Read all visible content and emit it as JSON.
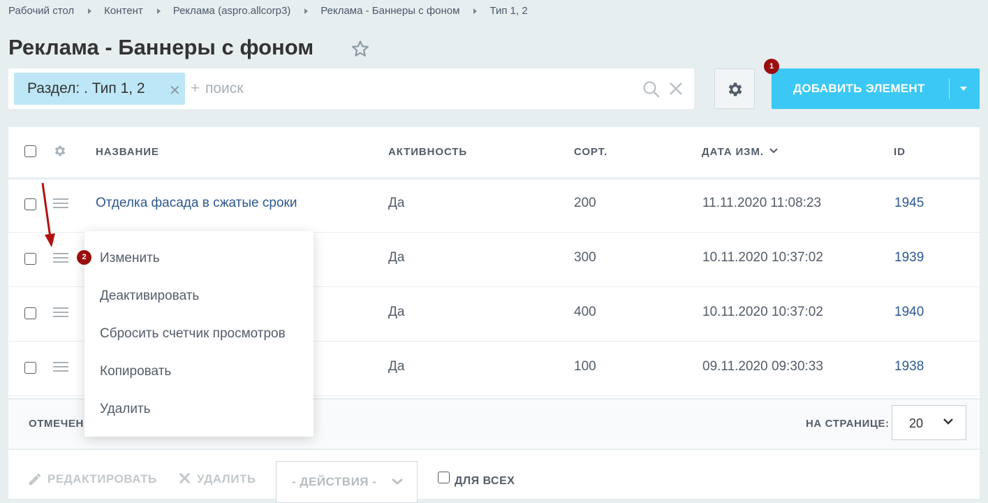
{
  "breadcrumbs": [
    "Рабочий стол",
    "Контент",
    "Реклама (aspro.allcorp3)",
    "Реклама - Баннеры с фоном",
    "Тип 1, 2"
  ],
  "page_title": "Реклама - Баннеры с фоном",
  "filter": {
    "chip_label": "Раздел: . Тип 1, 2",
    "search_plus": "+",
    "search_placeholder": "поиск"
  },
  "add_button": {
    "label": "ДОБАВИТЬ ЭЛЕМЕНТ"
  },
  "badges": {
    "first": "1",
    "second": "2"
  },
  "grid": {
    "headers": {
      "name": "НАЗВАНИЕ",
      "active": "АКТИВНОСТЬ",
      "sort": "СОРТ.",
      "date": "ДАТА ИЗМ.",
      "id": "ID"
    },
    "rows": [
      {
        "name": "Отделка фасада в сжатые сроки",
        "active": "Да",
        "sort": "200",
        "date": "11.11.2020 11:08:23",
        "id": "1945"
      },
      {
        "name": "",
        "active": "Да",
        "sort": "300",
        "date": "10.11.2020 10:37:02",
        "id": "1939"
      },
      {
        "name": "",
        "active": "Да",
        "sort": "400",
        "date": "10.11.2020 10:37:02",
        "id": "1940"
      },
      {
        "name": "",
        "active": "Да",
        "sort": "100",
        "date": "09.11.2020 09:30:33",
        "id": "1938"
      }
    ],
    "footer": {
      "marked_label": "ОТМЕЧЕН",
      "per_page_label": "НА СТРАНИЦЕ:",
      "per_page_value": "20"
    }
  },
  "context_menu": [
    "Изменить",
    "Деактивировать",
    "Сбросить счетчик просмотров",
    "Копировать",
    "Удалить"
  ],
  "action_bar": {
    "edit_label": "РЕДАКТИРОВАТЬ",
    "delete_label": "УДАЛИТЬ",
    "actions_label": "- ДЕЙСТВИЯ -",
    "for_all_label": "ДЛЯ ВСЕХ"
  },
  "colors": {
    "accent": "#3bc8f5",
    "chip_bg": "#bde7f6",
    "badge": "#9b0e0e",
    "link": "#2e5891",
    "page_bg": "#e7eef0"
  },
  "icons": [
    "star-icon",
    "search-icon",
    "close-icon",
    "gear-icon",
    "chevron-down-icon",
    "drag-handle-icon",
    "pencil-icon",
    "arrow-pointer-icon"
  ]
}
